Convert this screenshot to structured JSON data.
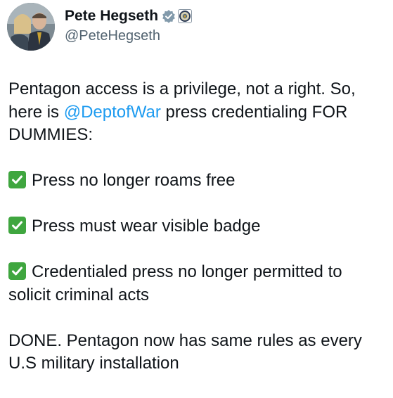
{
  "tweet": {
    "author": {
      "display_name": "Pete Hegseth",
      "handle": "@PeteHegseth",
      "verified_icon": "verified-badge-icon",
      "affiliation_icon": "government-seal-icon"
    },
    "text": {
      "intro_part1": "Pentagon access is a privilege, not a right. So, here is ",
      "intro_mention": "@DeptofWar",
      "intro_part2": " press credentialing FOR DUMMIES:",
      "rules": [
        "Press no longer roams free",
        "Press must wear visible badge",
        "Credentialed press no longer permitted to solicit criminal acts"
      ],
      "closing": "DONE. Pentagon now has same rules as every U.S military installation"
    },
    "colors": {
      "mention": "#1d9bf0",
      "checkmark_box": "#3fa63f",
      "handle": "#536471"
    }
  }
}
